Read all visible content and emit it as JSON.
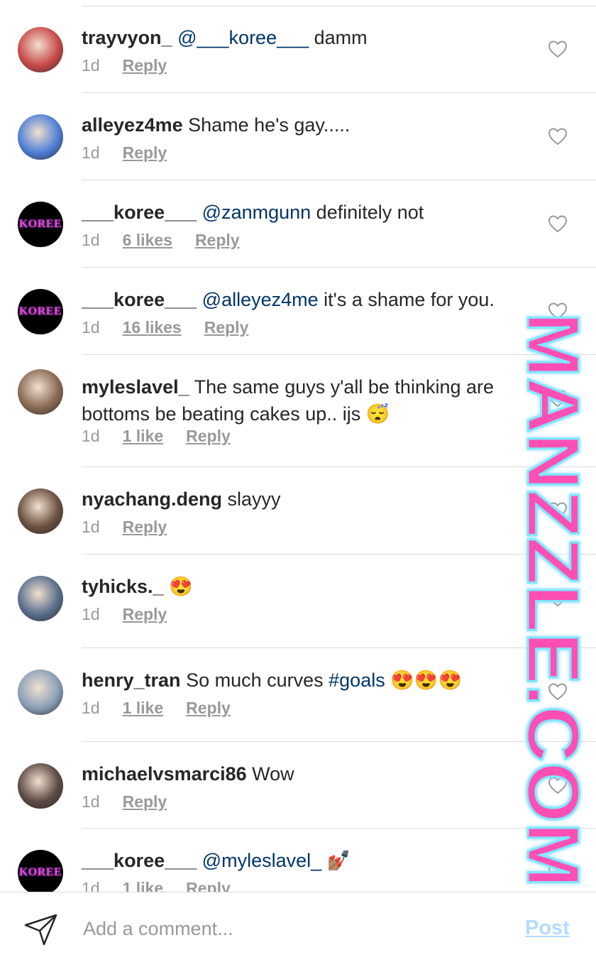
{
  "comments": [
    {
      "user": "trayvyon_",
      "mention": "@___koree___",
      "text": " damm",
      "time": "1d",
      "likes": "",
      "reply": "Reply",
      "avatar": "photo-avatar",
      "avatar_color": "#c94a4a"
    },
    {
      "user": "alleyez4me",
      "mention": "",
      "text": " Shame he's gay.....",
      "time": "1d",
      "likes": "",
      "reply": "Reply",
      "avatar": "photo-avatar",
      "avatar_color": "#4f7fd6"
    },
    {
      "user": "___koree___",
      "mention": "@zanmgunn",
      "text": " definitely not",
      "time": "1d",
      "likes": "6 likes",
      "reply": "Reply",
      "avatar": "koree-avatar",
      "avatar_text": "KOREE"
    },
    {
      "user": "___koree___",
      "mention": "@alleyez4me",
      "text": " it's a shame for you.",
      "time": "1d",
      "likes": "16 likes",
      "reply": "Reply",
      "avatar": "koree-avatar",
      "avatar_text": "KOREE"
    },
    {
      "user": "myleslavel_",
      "mention": "",
      "text": " The same guys y'all be thinking are bottoms be beating cakes up.. ijs 😴",
      "time": "1d",
      "likes": "1 like",
      "reply": "Reply",
      "avatar": "photo-avatar",
      "avatar_color": "#8a6a55"
    },
    {
      "user": "nyachang.deng",
      "mention": "",
      "text": " slayyy",
      "time": "1d",
      "likes": "",
      "reply": "Reply",
      "avatar": "photo-avatar",
      "avatar_color": "#6a5040"
    },
    {
      "user": "tyhicks._",
      "mention": "",
      "text": " 😍",
      "time": "1d",
      "likes": "",
      "reply": "Reply",
      "avatar": "photo-avatar",
      "avatar_color": "#5a6f8c"
    },
    {
      "user": "henry_tran",
      "mention": "",
      "text": " So much curves ",
      "tag": "#goals",
      "text2": " 😍😍😍",
      "time": "1d",
      "likes": "1 like",
      "reply": "Reply",
      "avatar": "photo-avatar",
      "avatar_color": "#8aa0b8"
    },
    {
      "user": "michaelvsmarci86",
      "mention": "",
      "text": " Wow",
      "time": "1d",
      "likes": "",
      "reply": "Reply",
      "avatar": "photo-avatar",
      "avatar_color": "#5c4a44"
    },
    {
      "user": "___koree___",
      "mention": "@myleslavel_",
      "text": " 💅🏽",
      "time": "1d",
      "likes": "1 like",
      "reply": "Reply",
      "avatar": "koree-avatar",
      "avatar_text": "KOREE"
    }
  ],
  "composer": {
    "placeholder": "Add a comment...",
    "post_label": "Post"
  },
  "watermark": {
    "text": "MANZZLE.COM",
    "color": "#ff4fb4"
  }
}
